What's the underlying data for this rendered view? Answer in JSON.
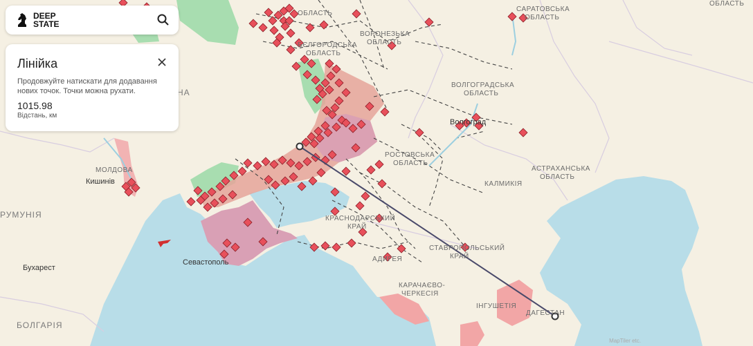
{
  "app": {
    "logo_line1": "DEEP",
    "logo_line2": "STATE",
    "search_icon": "search-icon"
  },
  "ruler": {
    "title": "Лінійка",
    "hint": "Продовжуйте натискати для додавання нових точок. Точки можна рухати.",
    "distance": "1015.98",
    "distance_label": "Відстань, км",
    "close_icon": "close-icon"
  },
  "map_labels": {
    "oblast_top": "ОБЛАСТЬ",
    "voronezh_1": "ВОРОНЕЗЬКА",
    "voronezh_2": "ОБЛАСТЬ",
    "belgorod_1": "БЄЛГОРОДСЬКА",
    "belgorod_2": "ОБЛАСТЬ",
    "saratov_1": "САРАТОВСЬКА",
    "saratov_2": "ОБЛАСТЬ",
    "top_right": "ОБЛАСТЬ",
    "volgograd_1": "ВОЛГОГРАДСЬКА",
    "volgograd_2": "ОБЛАСТЬ",
    "volgograd_city": "Волгоград",
    "rostov_1": "РОСТОВСЬКА",
    "rostov_2": "ОБЛАСТЬ",
    "astrakhan_1": "АСТРАХАНСЬКА",
    "astrakhan_2": "ОБЛАСТЬ",
    "kalmykia": "КАЛМИКІЯ",
    "krasnodar_1": "КРАСНОДАРСЬКИЙ",
    "krasnodar_2": "КРАЙ",
    "stavropol_1": "СТАВРОПОЛЬСЬКИЙ",
    "stavropol_2": "КРАЙ",
    "adygea": "АДИГЕЯ",
    "kchr_1": "КАРАЧАЄВО-",
    "kchr_2": "ЧЕРКЕСІЯ",
    "ingushetia": "ІНГУШЕТІЯ",
    "dagestan": "ДАГЕСТАН",
    "moldova": "МОЛДОВА",
    "chisinau": "Кишинів",
    "romania": "РУМУНІЯ",
    "bucharest": "Бухарест",
    "bulgaria": "БОЛГАРІЯ",
    "sevastopol": "Севастополь",
    "ukraine_frag": "НА"
  },
  "attribution": "MapTiler etc.",
  "colors": {
    "land": "#f5f0e3",
    "sea": "#b8dde8",
    "occupied": "#e5a49a",
    "crimea": "#d9a0b5",
    "liberated": "#a8ddb0",
    "marker": "#e8505b",
    "ruler_line": "#4a4a6a"
  }
}
